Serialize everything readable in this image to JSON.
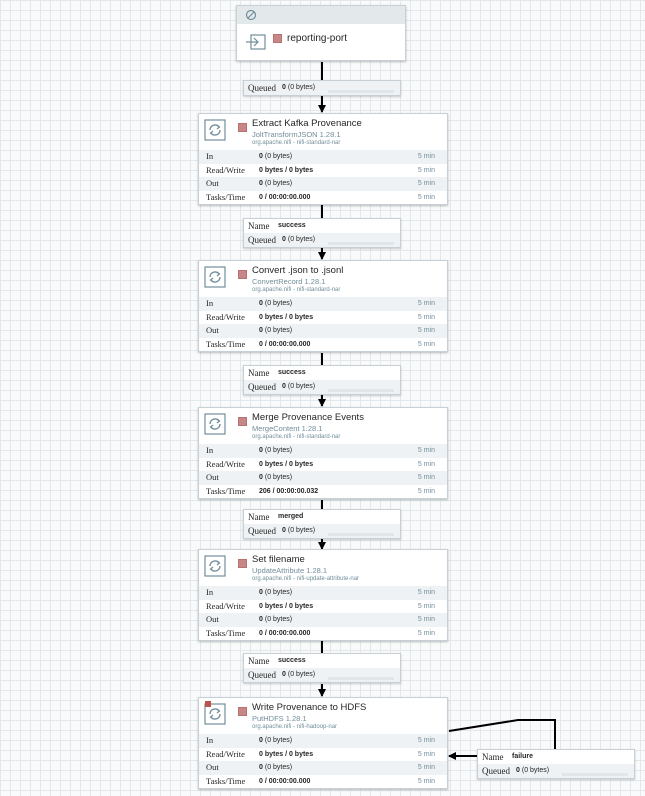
{
  "flow": {
    "input_port": {
      "name": "reporting-port"
    },
    "processors": [
      {
        "name": "Extract Kafka Provenance",
        "type": "JoltTransformJSON 1.28.1",
        "bundle": "org.apache.nifi - nifi-standard-nar",
        "stats": [
          {
            "label": "In",
            "value": "0",
            "sub": "(0 bytes)",
            "time": "5 min"
          },
          {
            "label": "Read/Write",
            "value": "0 bytes / 0 bytes",
            "sub": "",
            "time": "5 min"
          },
          {
            "label": "Out",
            "value": "0",
            "sub": "(0 bytes)",
            "time": "5 min"
          },
          {
            "label": "Tasks/Time",
            "value": "0 / 00:00:00.000",
            "sub": "",
            "time": "5 min"
          }
        ]
      },
      {
        "name": "Convert .json to .jsonl",
        "type": "ConvertRecord 1.28.1",
        "bundle": "org.apache.nifi - nifi-standard-nar",
        "stats": [
          {
            "label": "In",
            "value": "0",
            "sub": "(0 bytes)",
            "time": "5 min"
          },
          {
            "label": "Read/Write",
            "value": "0 bytes / 0 bytes",
            "sub": "",
            "time": "5 min"
          },
          {
            "label": "Out",
            "value": "0",
            "sub": "(0 bytes)",
            "time": "5 min"
          },
          {
            "label": "Tasks/Time",
            "value": "0 / 00:00:00.000",
            "sub": "",
            "time": "5 min"
          }
        ]
      },
      {
        "name": "Merge Provenance Events",
        "type": "MergeContent 1.28.1",
        "bundle": "org.apache.nifi - nifi-standard-nar",
        "stats": [
          {
            "label": "In",
            "value": "0",
            "sub": "(0 bytes)",
            "time": "5 min"
          },
          {
            "label": "Read/Write",
            "value": "0 bytes / 0 bytes",
            "sub": "",
            "time": "5 min"
          },
          {
            "label": "Out",
            "value": "0",
            "sub": "(0 bytes)",
            "time": "5 min"
          },
          {
            "label": "Tasks/Time",
            "value": "206 / 00:00:00.032",
            "sub": "",
            "time": "5 min"
          }
        ]
      },
      {
        "name": "Set filename",
        "type": "UpdateAttribute 1.28.1",
        "bundle": "org.apache.nifi - nifi-update-attribute-nar",
        "stats": [
          {
            "label": "In",
            "value": "0",
            "sub": "(0 bytes)",
            "time": "5 min"
          },
          {
            "label": "Read/Write",
            "value": "0 bytes / 0 bytes",
            "sub": "",
            "time": "5 min"
          },
          {
            "label": "Out",
            "value": "0",
            "sub": "(0 bytes)",
            "time": "5 min"
          },
          {
            "label": "Tasks/Time",
            "value": "0 / 00:00:00.000",
            "sub": "",
            "time": "5 min"
          }
        ]
      },
      {
        "name": "Write Provenance to HDFS",
        "type": "PutHDFS 1.28.1",
        "bundle": "org.apache.nifi - nifi-hadoop-nar",
        "stats": [
          {
            "label": "In",
            "value": "0",
            "sub": "(0 bytes)",
            "time": "5 min"
          },
          {
            "label": "Read/Write",
            "value": "0 bytes / 0 bytes",
            "sub": "",
            "time": "5 min"
          },
          {
            "label": "Out",
            "value": "0",
            "sub": "(0 bytes)",
            "time": "5 min"
          },
          {
            "label": "Tasks/Time",
            "value": "0 / 00:00:00.000",
            "sub": "",
            "time": "5 min"
          }
        ]
      }
    ],
    "connections": [
      {
        "name_label": "",
        "name": "",
        "queued_label": "Queued",
        "queued": "0",
        "queued_sub": "(0 bytes)",
        "queue_fill": 0
      },
      {
        "name_label": "Name",
        "name": "success",
        "queued_label": "Queued",
        "queued": "0",
        "queued_sub": "(0 bytes)",
        "queue_fill": 0
      },
      {
        "name_label": "Name",
        "name": "success",
        "queued_label": "Queued",
        "queued": "0",
        "queued_sub": "(0 bytes)",
        "queue_fill": 0
      },
      {
        "name_label": "Name",
        "name": "merged",
        "queued_label": "Queued",
        "queued": "0",
        "queued_sub": "(0 bytes)",
        "queue_fill": 0
      },
      {
        "name_label": "Name",
        "name": "success",
        "queued_label": "Queued",
        "queued": "0",
        "queued_sub": "(0 bytes)",
        "queue_fill": 0
      },
      {
        "name_label": "Name",
        "name": "failure",
        "queued_label": "Queued",
        "queued": "0",
        "queued_sub": "(0 bytes)",
        "queue_fill": 0
      }
    ],
    "colors": {
      "canvas_bg": "#f9fafb",
      "grid": "#e3e8eb",
      "stopped": "#c78787",
      "secondary_text": "#728e9b",
      "stat_row_alt": "#eef2f4"
    }
  }
}
